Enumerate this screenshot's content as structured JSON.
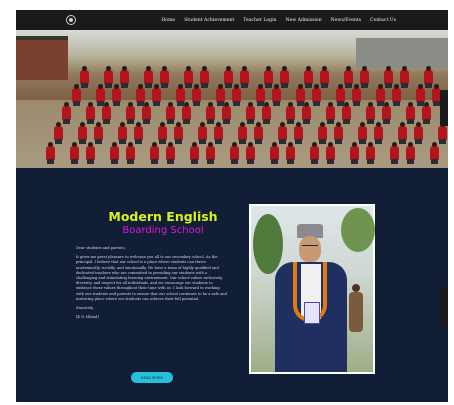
{
  "nav": {
    "items": [
      "Home",
      "Student Achievement",
      "Teacher Login",
      "New Admission",
      "News/Events",
      "Contact Us"
    ]
  },
  "welcome": {
    "title_line1": "Modern English",
    "title_line2": "Boarding School",
    "greeting": "Dear students and parents,",
    "paragraph": "It gives me great pleasure to welcome you all to our secondary school. As the principal, I believe that our school is a place where students can thrive academically, socially, and emotionally. We have a team of highly qualified and dedicated teachers who are committed to providing our students with a challenging and stimulating learning environment. Our school values inclusivity, diversity, and respect for all individuals, and we encourage our students to embrace these values throughout their time with us. I look forward to working with our students and parents to ensure that our school continues to be a safe and nurturing place where our students can achieve their full potential.",
    "closing": "Sincerely,",
    "signature": "[K N Mhind]",
    "button_label": "READ MORE"
  },
  "colors": {
    "title_line1": "#d8f31a",
    "title_line2": "#d91ad6",
    "button": "#26c1d9",
    "content_bg": "#121d36"
  }
}
